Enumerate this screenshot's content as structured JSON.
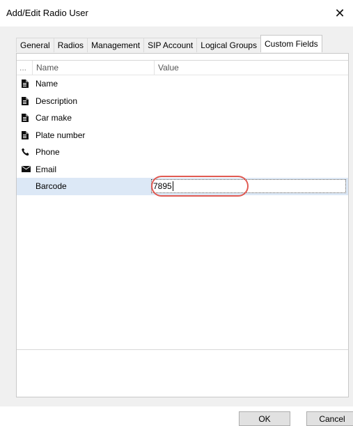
{
  "window": {
    "title": "Add/Edit Radio User",
    "close_glyph": "✕"
  },
  "tabs": [
    {
      "label": "General",
      "active": false
    },
    {
      "label": "Radios",
      "active": false
    },
    {
      "label": "Management",
      "active": false
    },
    {
      "label": "SIP Account",
      "active": false
    },
    {
      "label": "Logical Groups",
      "active": false
    },
    {
      "label": "Custom Fields",
      "active": true
    }
  ],
  "grid": {
    "columns": {
      "first": "...",
      "name": "Name",
      "value": "Value"
    },
    "rows": [
      {
        "icon": "document-icon",
        "name": "Name",
        "value": ""
      },
      {
        "icon": "document-icon",
        "name": "Description",
        "value": ""
      },
      {
        "icon": "document-icon",
        "name": "Car make",
        "value": ""
      },
      {
        "icon": "document-icon",
        "name": "Plate number",
        "value": ""
      },
      {
        "icon": "phone-icon",
        "name": "Phone",
        "value": ""
      },
      {
        "icon": "envelope-icon",
        "name": "Email",
        "value": ""
      },
      {
        "icon": "",
        "name": "Barcode",
        "value": "7895",
        "selected": true,
        "editing": true
      }
    ]
  },
  "buttons": {
    "ok": "OK",
    "cancel": "Cancel"
  },
  "colors": {
    "selection": "#dce8f6",
    "highlight_ring": "#e05a52"
  }
}
